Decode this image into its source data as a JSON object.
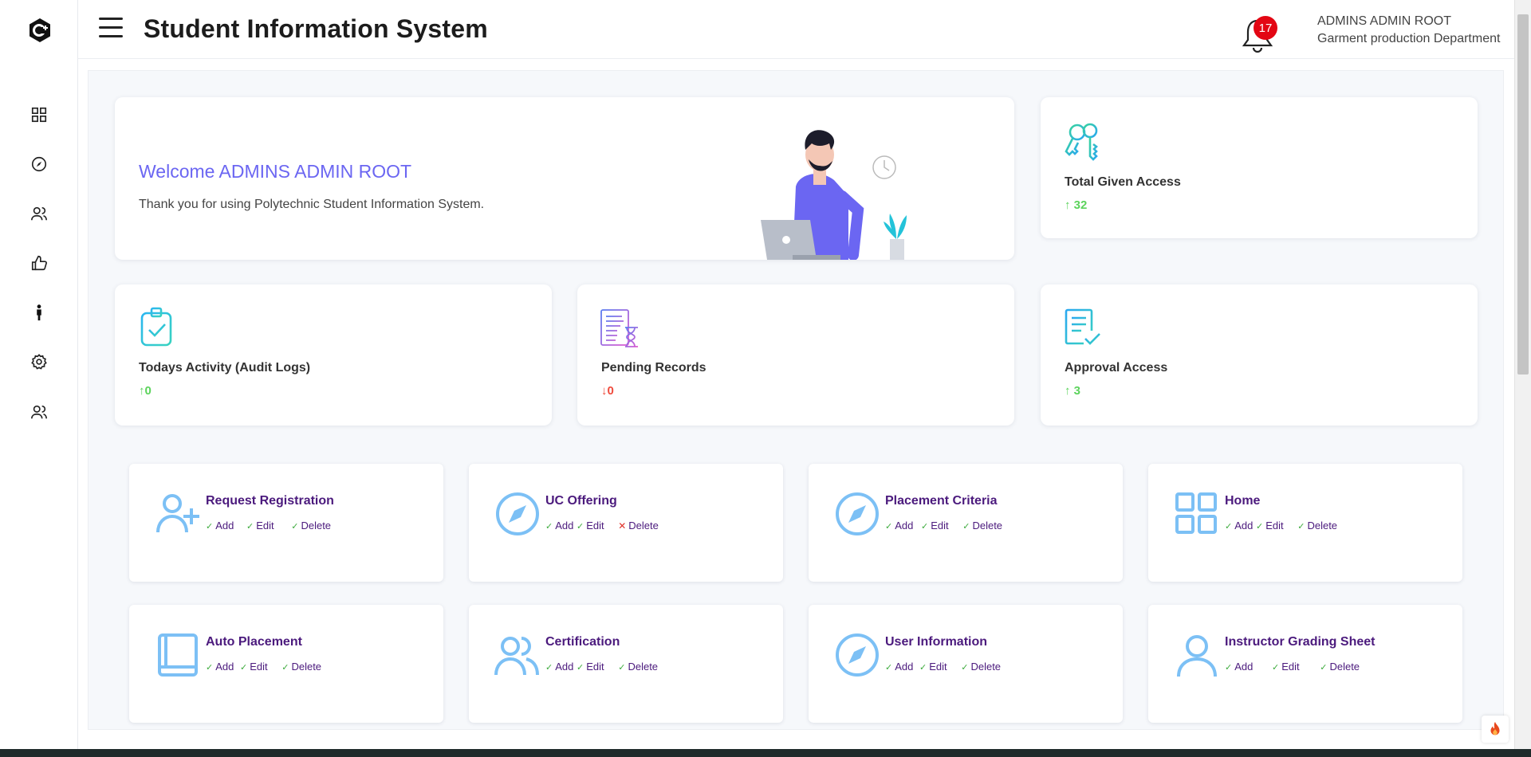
{
  "app": {
    "title": "Student Information System"
  },
  "header": {
    "notification_count": "17",
    "user_name": "ADMINS ADMIN ROOT",
    "department": "Garment production Department"
  },
  "sidebar": {
    "items": [
      {
        "icon": "dashboard-grid-icon"
      },
      {
        "icon": "compass-icon"
      },
      {
        "icon": "users-icon"
      },
      {
        "icon": "thumbs-up-icon"
      },
      {
        "icon": "person-icon"
      },
      {
        "icon": "gear-icon"
      },
      {
        "icon": "users-icon"
      }
    ]
  },
  "welcome": {
    "title": "Welcome ADMINS ADMIN ROOT",
    "text": "Thank you for using Polytechnic Student Information System."
  },
  "stats": [
    {
      "label": "Total Given Access",
      "value": "32",
      "trend": "up",
      "icon": "keys-icon"
    },
    {
      "label": "Todays Activity (Audit Logs)",
      "value": "0",
      "trend": "up",
      "icon": "clipboard-check-icon"
    },
    {
      "label": "Pending Records",
      "value": "0",
      "trend": "down",
      "icon": "document-hourglass-icon"
    },
    {
      "label": "Approval Access",
      "value": "3",
      "trend": "up",
      "icon": "document-check-icon"
    }
  ],
  "modules": [
    {
      "title": "Request Registration",
      "icon": "add-user-icon",
      "actions": [
        {
          "label": "Add",
          "allowed": true
        },
        {
          "label": "Edit",
          "allowed": true
        },
        {
          "label": "Delete",
          "allowed": true
        }
      ]
    },
    {
      "title": "UC Offering",
      "icon": "compass-icon",
      "actions": [
        {
          "label": "Add",
          "allowed": true
        },
        {
          "label": "Edit",
          "allowed": true
        },
        {
          "label": "Delete",
          "allowed": false
        }
      ]
    },
    {
      "title": "Placement Criteria",
      "icon": "compass-icon",
      "actions": [
        {
          "label": "Add",
          "allowed": true
        },
        {
          "label": "Edit",
          "allowed": true
        },
        {
          "label": "Delete",
          "allowed": true
        }
      ]
    },
    {
      "title": "Home",
      "icon": "grid-icon",
      "actions": [
        {
          "label": "Add",
          "allowed": true
        },
        {
          "label": "Edit",
          "allowed": true
        },
        {
          "label": "Delete",
          "allowed": true
        }
      ]
    },
    {
      "title": "Auto Placement",
      "icon": "book-icon",
      "actions": [
        {
          "label": "Add",
          "allowed": true
        },
        {
          "label": "Edit",
          "allowed": true
        },
        {
          "label": "Delete",
          "allowed": true
        }
      ]
    },
    {
      "title": "Certification",
      "icon": "users-icon",
      "actions": [
        {
          "label": "Add",
          "allowed": true
        },
        {
          "label": "Edit",
          "allowed": true
        },
        {
          "label": "Delete",
          "allowed": true
        }
      ]
    },
    {
      "title": "User Information",
      "icon": "compass-icon",
      "actions": [
        {
          "label": "Add",
          "allowed": true
        },
        {
          "label": "Edit",
          "allowed": true
        },
        {
          "label": "Delete",
          "allowed": true
        }
      ]
    },
    {
      "title": "Instructor Grading Sheet",
      "icon": "user-icon",
      "actions": [
        {
          "label": "Add",
          "allowed": true
        },
        {
          "label": "Edit",
          "allowed": true
        },
        {
          "label": "Delete",
          "allowed": true
        }
      ]
    }
  ],
  "colors": {
    "accent": "#6b66f2",
    "module_title": "#4b1a7d",
    "module_icon": "#7cc0f5",
    "trend_up": "#5cd35c",
    "trend_down": "#ef4a3c",
    "badge": "#e30613"
  }
}
